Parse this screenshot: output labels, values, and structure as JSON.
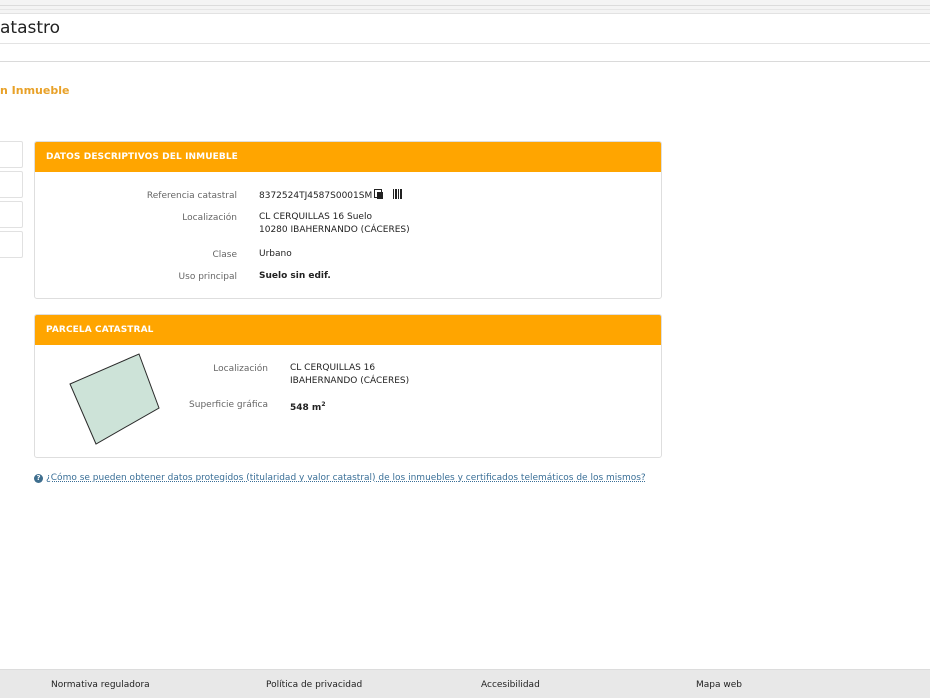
{
  "header": {
    "app_title": "atastro"
  },
  "page": {
    "heading": "n Inmueble"
  },
  "descriptive_panel": {
    "title": "DATOS DESCRIPTIVOS DEL INMUEBLE",
    "ref_label": "Referencia catastral",
    "ref_value": "8372524TJ4587S0001SM",
    "loc_label": "Localización",
    "loc_line1": "CL CERQUILLAS 16 Suelo",
    "loc_line2": "10280 IBAHERNANDO (CÁCERES)",
    "class_label": "Clase",
    "class_value": "Urbano",
    "use_label": "Uso principal",
    "use_value": "Suelo sin edif."
  },
  "parcel_panel": {
    "title": "PARCELA CATASTRAL",
    "loc_label": "Localización",
    "loc_line1": "CL CERQUILLAS 16",
    "loc_line2": "IBAHERNANDO (CÁCERES)",
    "area_label": "Superficie gráfica",
    "area_value": "548 m",
    "area_unit_sup": "2"
  },
  "help": {
    "icon_text": "?",
    "link_text": "¿Cómo se pueden obtener datos protegidos (titularidad y valor catastral) de los inmuebles y certificados telemáticos de los mismos?"
  },
  "footer": {
    "links": [
      "Normativa reguladora",
      "Política de privacidad",
      "Accesibilidad",
      "Mapa web"
    ]
  },
  "colors": {
    "accent": "#ffa500",
    "heading": "#e8a128",
    "link": "#3a6f97",
    "parcel_fill": "#cde3d8"
  },
  "icons": [
    "copy-icon",
    "barcode-icon",
    "help-icon"
  ]
}
